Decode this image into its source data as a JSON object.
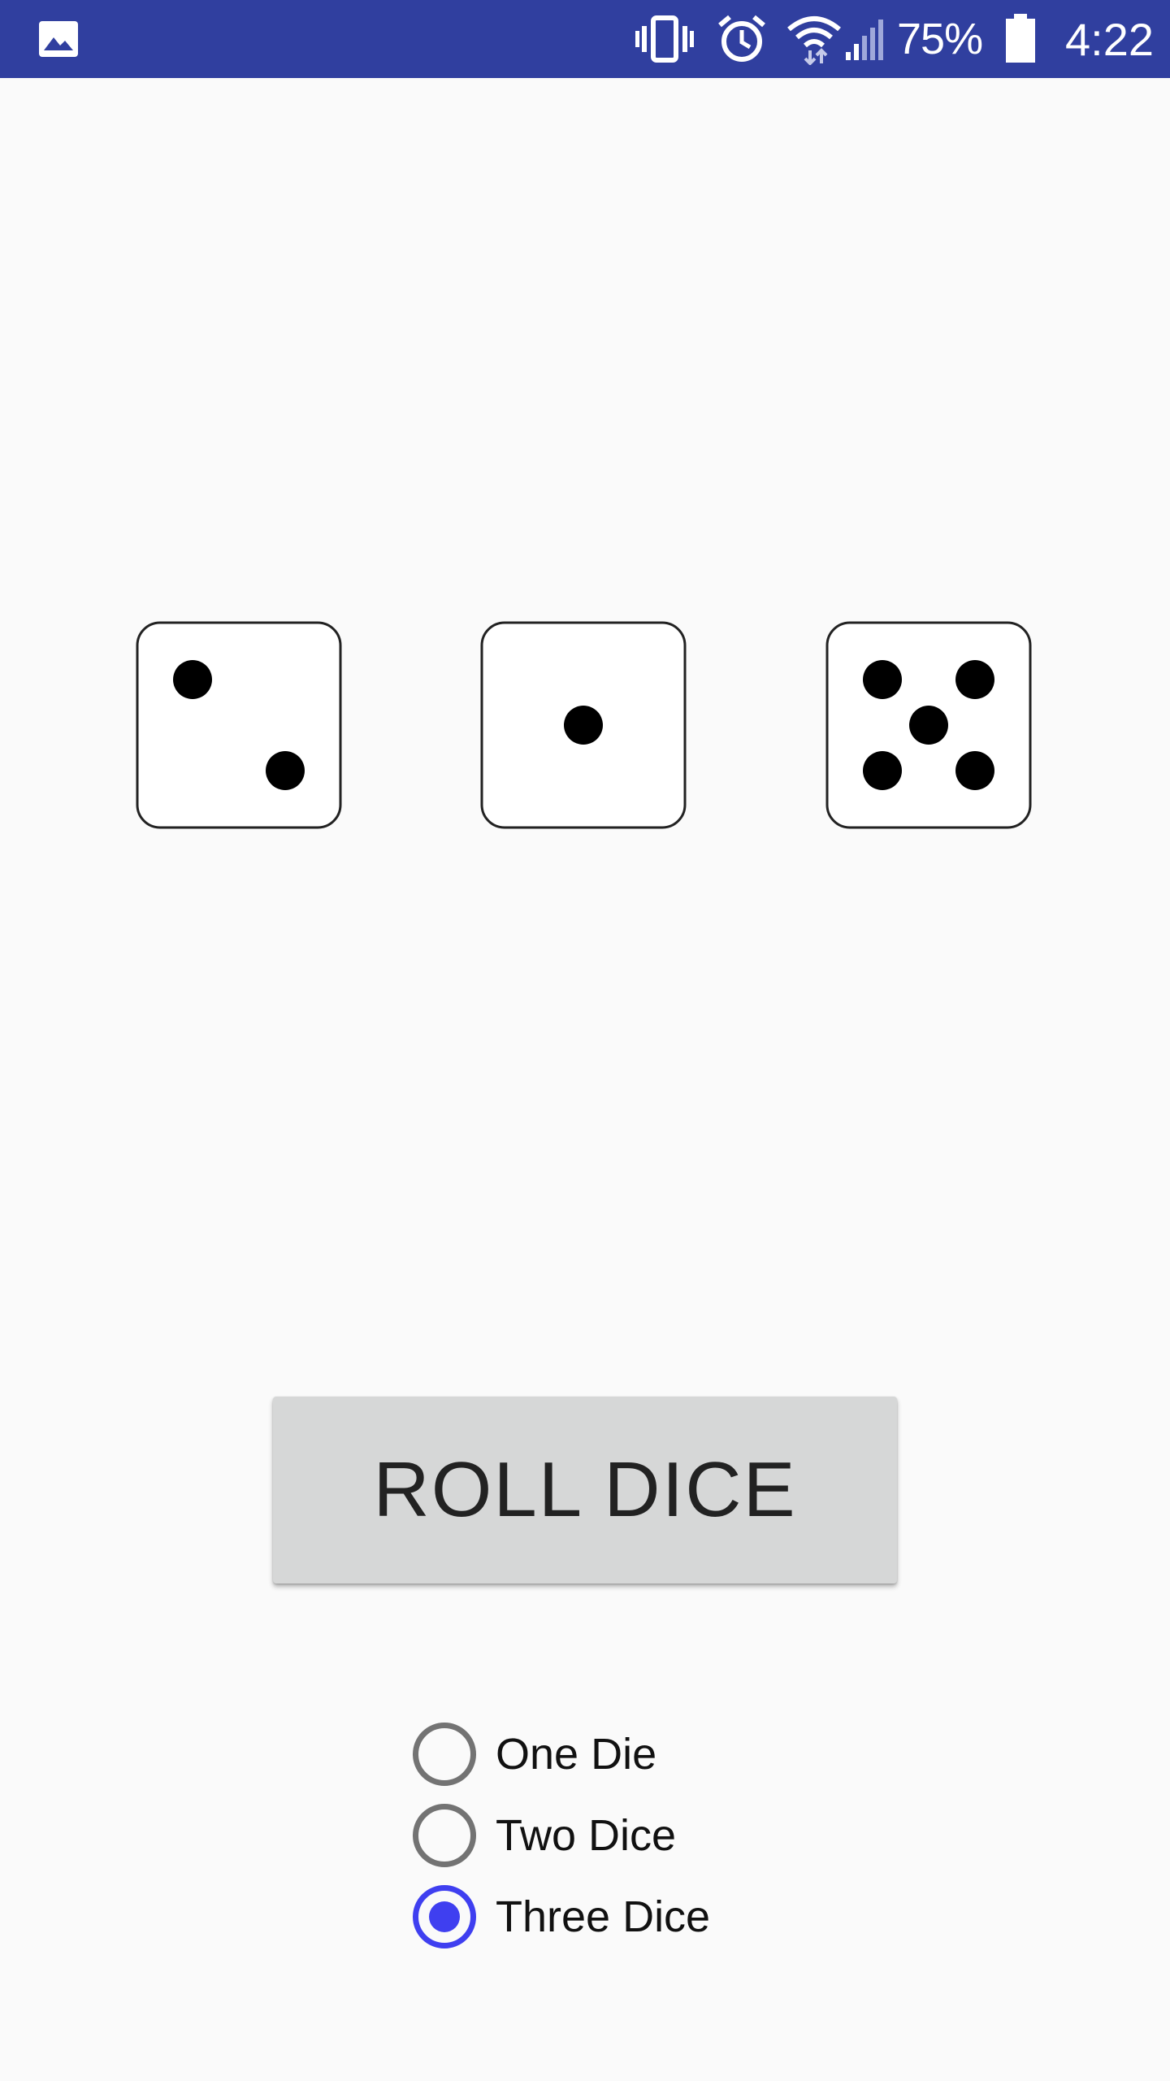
{
  "status_bar": {
    "notification_icon": "image-icon",
    "icons": [
      "vibrate-icon",
      "alarm-icon",
      "wifi-icon",
      "signal-icon",
      "battery-icon"
    ],
    "battery_percent": "75%",
    "time": "4:22",
    "background_color": "#303f9f"
  },
  "dice": [
    {
      "name": "die-1",
      "value": 2
    },
    {
      "name": "die-2",
      "value": 1
    },
    {
      "name": "die-3",
      "value": 5
    }
  ],
  "roll_button": {
    "label": "ROLL DICE"
  },
  "dice_count_options": [
    {
      "label": "One Die",
      "checked": false
    },
    {
      "label": "Two Dice",
      "checked": false
    },
    {
      "label": "Three Dice",
      "checked": true
    }
  ],
  "accent_color": "#3f3ff0"
}
